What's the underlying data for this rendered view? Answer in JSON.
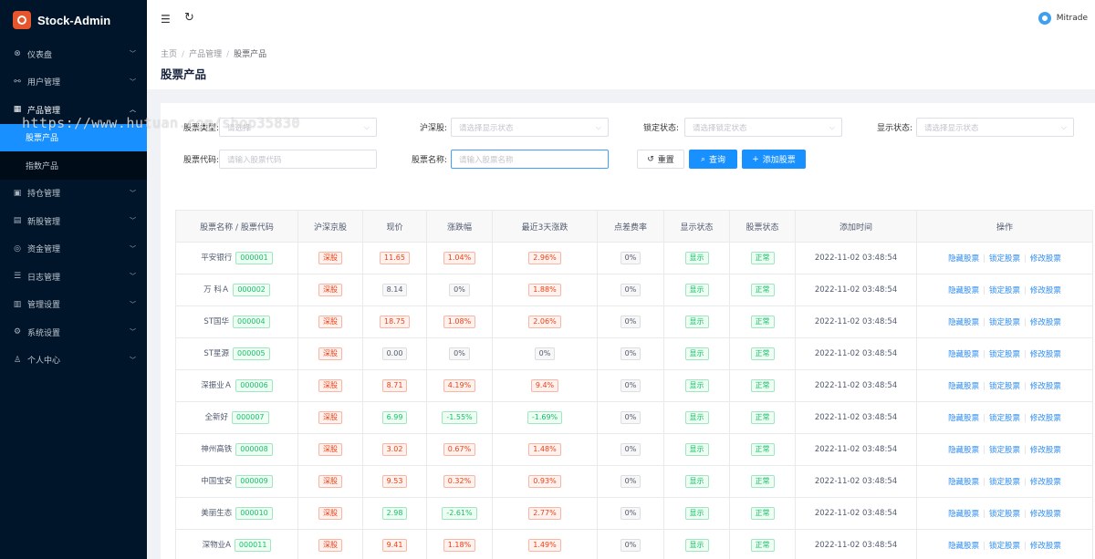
{
  "app": {
    "title": "Stock-Admin"
  },
  "sidebar": {
    "items": [
      {
        "icon": "dashboard-icon",
        "glyph": "⊗",
        "label": "仪表盘"
      },
      {
        "icon": "user-icon",
        "glyph": "⚯",
        "label": "用户管理"
      },
      {
        "icon": "chart-icon",
        "glyph": "▦",
        "label": "产品管理",
        "open": true,
        "children": [
          {
            "label": "股票产品",
            "active": true
          },
          {
            "label": "指数产品"
          }
        ]
      },
      {
        "icon": "holding-icon",
        "glyph": "▣",
        "label": "持仓管理"
      },
      {
        "icon": "ipo-icon",
        "glyph": "▤",
        "label": "新股管理"
      },
      {
        "icon": "fund-icon",
        "glyph": "◎",
        "label": "资金管理"
      },
      {
        "icon": "log-icon",
        "glyph": "☰",
        "label": "日志管理"
      },
      {
        "icon": "settings-icon",
        "glyph": "▥",
        "label": "管理设置"
      },
      {
        "icon": "system-icon",
        "glyph": "⚙",
        "label": "系统设置"
      },
      {
        "icon": "person-icon",
        "glyph": "♙",
        "label": "个人中心"
      }
    ]
  },
  "header": {
    "user": "Mitrade"
  },
  "breadcrumb": [
    "主页",
    "产品管理",
    "股票产品"
  ],
  "page_title": "股票产品",
  "watermark": "https://www.hutuan.com/shop35830",
  "filters": {
    "row1": [
      {
        "label": "股票类型:",
        "placeholder": "请选择"
      },
      {
        "label": "沪深股:",
        "placeholder": "请选择显示状态"
      },
      {
        "label": "锁定状态:",
        "placeholder": "请选择锁定状态"
      },
      {
        "label": "显示状态:",
        "placeholder": "请选择显示状态"
      }
    ],
    "row2": [
      {
        "label": "股票代码:",
        "placeholder": "请输入股票代码"
      },
      {
        "label": "股票名称:",
        "placeholder": "请输入股票名称"
      }
    ],
    "buttons": {
      "reset": "重置",
      "search": "查询",
      "add": "添加股票"
    }
  },
  "table": {
    "columns": [
      "股票名称 / 股票代码",
      "沪深京股",
      "现价",
      "涨跌幅",
      "最近3天涨跌",
      "点差费率",
      "显示状态",
      "股票状态",
      "添加时间",
      "操作"
    ],
    "ops": [
      "隐藏股票",
      "锁定股票",
      "修改股票"
    ],
    "rows": [
      {
        "name": "平安银行",
        "code": "000001",
        "market": "深股",
        "price": "11.65",
        "price_c": "red",
        "chg": "1.04%",
        "chg_c": "red",
        "chg3": "2.96%",
        "chg3_c": "red",
        "fee": "0%",
        "show": "显示",
        "status": "正常",
        "time": "2022-11-02 03:48:54"
      },
      {
        "name": "万 科Ａ",
        "code": "000002",
        "market": "深股",
        "price": "8.14",
        "price_c": "gray",
        "chg": "0%",
        "chg_c": "gray",
        "chg3": "1.88%",
        "chg3_c": "red",
        "fee": "0%",
        "show": "显示",
        "status": "正常",
        "time": "2022-11-02 03:48:54"
      },
      {
        "name": "ST国华",
        "code": "000004",
        "market": "深股",
        "price": "18.75",
        "price_c": "red",
        "chg": "1.08%",
        "chg_c": "red",
        "chg3": "2.06%",
        "chg3_c": "red",
        "fee": "0%",
        "show": "显示",
        "status": "正常",
        "time": "2022-11-02 03:48:54"
      },
      {
        "name": "ST星源",
        "code": "000005",
        "market": "深股",
        "price": "0.00",
        "price_c": "gray",
        "chg": "0%",
        "chg_c": "gray",
        "chg3": "0%",
        "chg3_c": "gray",
        "fee": "0%",
        "show": "显示",
        "status": "正常",
        "time": "2022-11-02 03:48:54"
      },
      {
        "name": "深振业Ａ",
        "code": "000006",
        "market": "深股",
        "price": "8.71",
        "price_c": "red",
        "chg": "4.19%",
        "chg_c": "red",
        "chg3": "9.4%",
        "chg3_c": "red",
        "fee": "0%",
        "show": "显示",
        "status": "正常",
        "time": "2022-11-02 03:48:54"
      },
      {
        "name": "全新好",
        "code": "000007",
        "market": "深股",
        "price": "6.99",
        "price_c": "green",
        "chg": "-1.55%",
        "chg_c": "green",
        "chg3": "-1.69%",
        "chg3_c": "green",
        "fee": "0%",
        "show": "显示",
        "status": "正常",
        "time": "2022-11-02 03:48:54"
      },
      {
        "name": "神州高铁",
        "code": "000008",
        "market": "深股",
        "price": "3.02",
        "price_c": "red",
        "chg": "0.67%",
        "chg_c": "red",
        "chg3": "1.48%",
        "chg3_c": "red",
        "fee": "0%",
        "show": "显示",
        "status": "正常",
        "time": "2022-11-02 03:48:54"
      },
      {
        "name": "中国宝安",
        "code": "000009",
        "market": "深股",
        "price": "9.53",
        "price_c": "red",
        "chg": "0.32%",
        "chg_c": "red",
        "chg3": "0.93%",
        "chg3_c": "red",
        "fee": "0%",
        "show": "显示",
        "status": "正常",
        "time": "2022-11-02 03:48:54"
      },
      {
        "name": "美丽生态",
        "code": "000010",
        "market": "深股",
        "price": "2.98",
        "price_c": "green",
        "chg": "-2.61%",
        "chg_c": "green",
        "chg3": "2.77%",
        "chg3_c": "red",
        "fee": "0%",
        "show": "显示",
        "status": "正常",
        "time": "2022-11-02 03:48:54"
      },
      {
        "name": "深物业A",
        "code": "000011",
        "market": "深股",
        "price": "9.41",
        "price_c": "red",
        "chg": "1.18%",
        "chg_c": "red",
        "chg3": "1.49%",
        "chg3_c": "red",
        "fee": "0%",
        "show": "显示",
        "status": "正常",
        "time": "2022-11-02 03:48:54"
      }
    ]
  }
}
